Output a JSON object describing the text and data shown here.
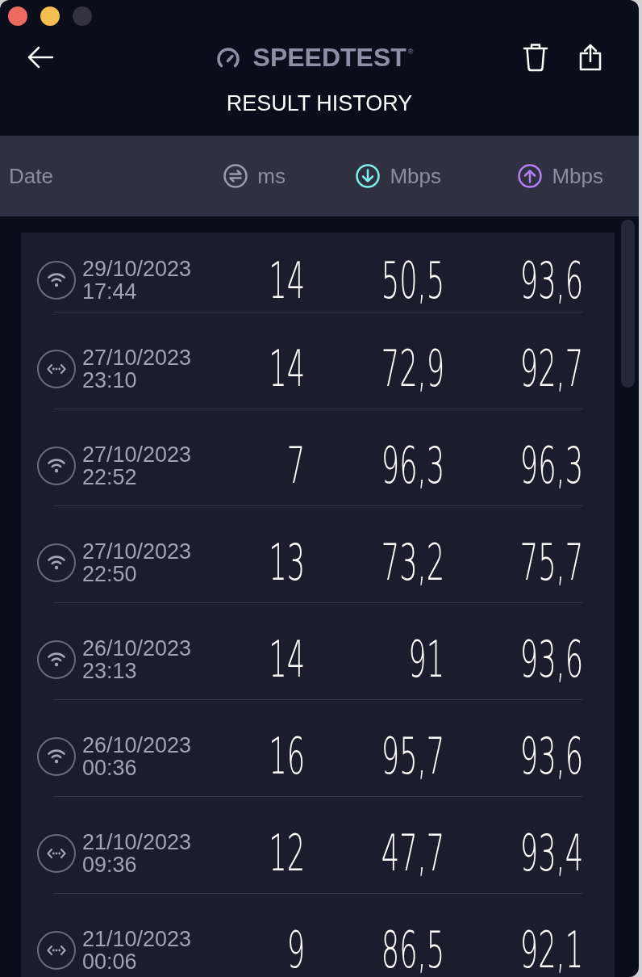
{
  "window_controls": [
    {
      "color": "#ec6a5e"
    },
    {
      "color": "#f4bf4f"
    },
    {
      "color": "#33323e"
    }
  ],
  "header": {
    "logo": {
      "text": "SPEEDTEST",
      "mark": "®"
    },
    "title": "RESULT HISTORY"
  },
  "columns": [
    {
      "kind": "date",
      "label": "Date"
    },
    {
      "kind": "ping",
      "label": "ms",
      "color": "#9a9bab"
    },
    {
      "kind": "download",
      "label": "Mbps",
      "color": "#7ff0ec"
    },
    {
      "kind": "upload",
      "label": "Mbps",
      "color": "#b57ef2"
    }
  ],
  "results": [
    {
      "kind": "wifi",
      "date": "29/10/2023",
      "time": "17:44",
      "ping": "14",
      "download": "50,5",
      "upload": "93,6"
    },
    {
      "kind": "ethernet",
      "date": "27/10/2023",
      "time": "23:10",
      "ping": "14",
      "download": "72,9",
      "upload": "92,7"
    },
    {
      "kind": "wifi",
      "date": "27/10/2023",
      "time": "22:52",
      "ping": "7",
      "download": "96,3",
      "upload": "96,3"
    },
    {
      "kind": "wifi",
      "date": "27/10/2023",
      "time": "22:50",
      "ping": "13",
      "download": "73,2",
      "upload": "75,7"
    },
    {
      "kind": "wifi",
      "date": "26/10/2023",
      "time": "23:13",
      "ping": "14",
      "download": "91",
      "upload": "93,6"
    },
    {
      "kind": "wifi",
      "date": "26/10/2023",
      "time": "00:36",
      "ping": "16",
      "download": "95,7",
      "upload": "93,6"
    },
    {
      "kind": "ethernet",
      "date": "21/10/2023",
      "time": "09:36",
      "ping": "12",
      "download": "47,7",
      "upload": "93,4"
    },
    {
      "kind": "ethernet",
      "date": "21/10/2023",
      "time": "00:06",
      "ping": "9",
      "download": "86,5",
      "upload": "92,1"
    }
  ]
}
